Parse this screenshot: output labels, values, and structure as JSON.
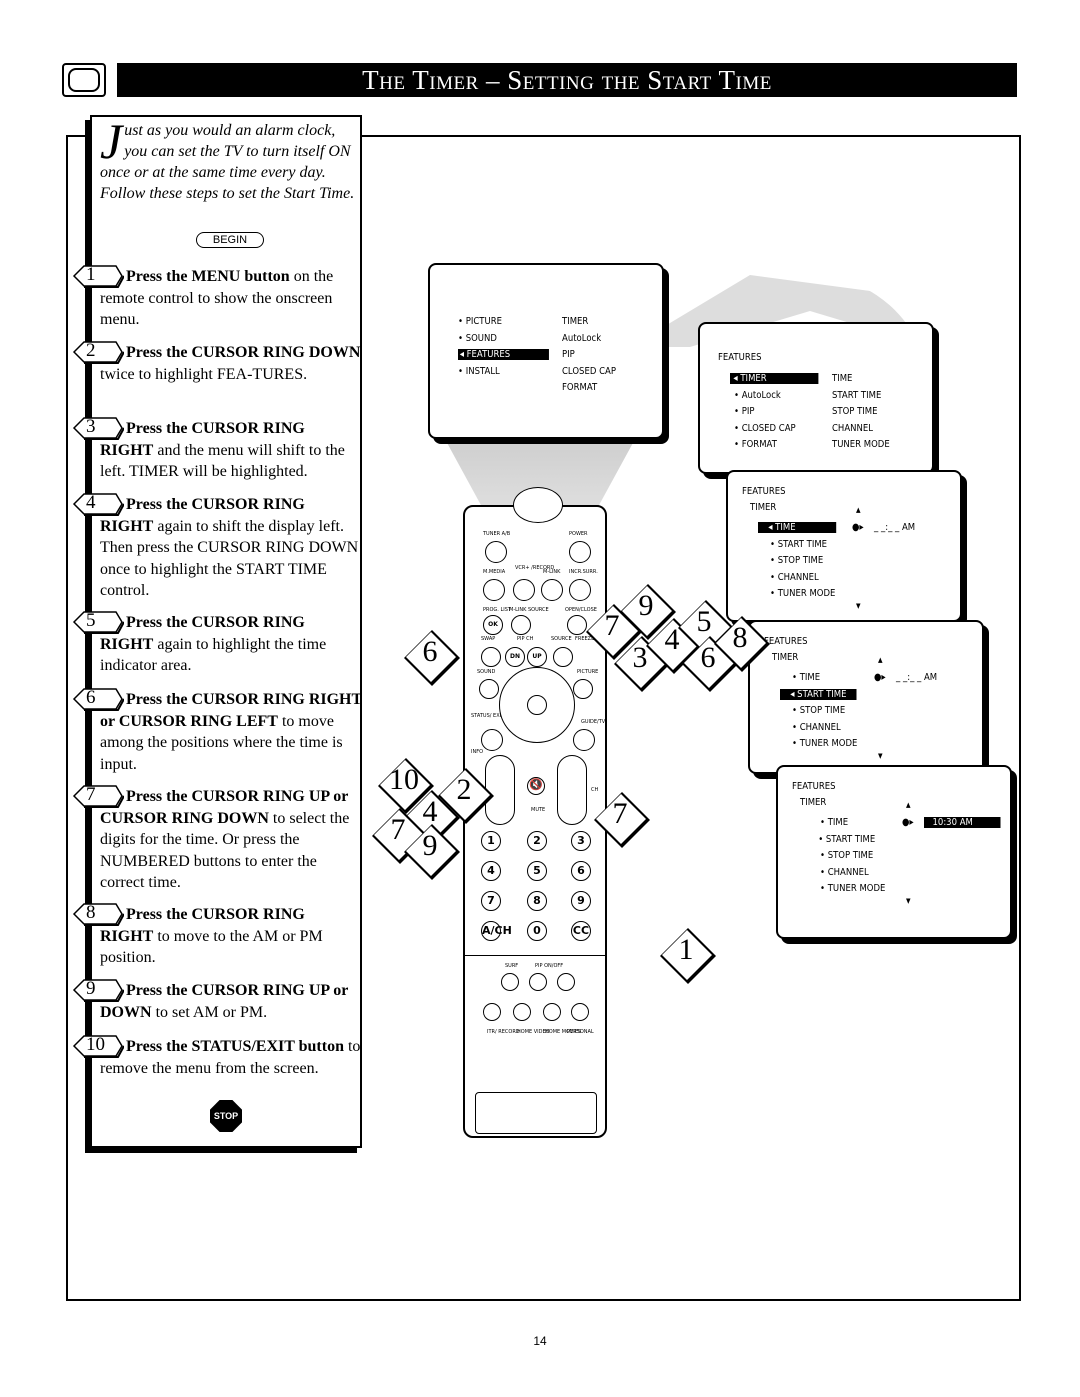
{
  "header": {
    "title": "The Timer – Setting the Start Time",
    "icon": "tv-icon"
  },
  "intro": {
    "dropcap": "J",
    "text": "ust as you would an alarm clock, you can set the TV to turn itself ON once or at the same time every day. Follow these steps to set the Start Time.",
    "begin_label": "BEGIN"
  },
  "steps": [
    {
      "num": "1",
      "bold": "Press the MENU button",
      "rest": " on the remote control to show the onscreen menu."
    },
    {
      "num": "2",
      "bold": "Press the CURSOR RING DOWN",
      "rest": " twice to highlight FEA-TURES."
    },
    {
      "num": "3",
      "bold": "Press the CURSOR RING RIGHT",
      "rest": " and the menu will shift to the left. TIMER will be highlighted."
    },
    {
      "num": "4",
      "bold": "Press the CURSOR RING RIGHT",
      "rest": " again to shift the display left. Then press the CURSOR RING DOWN once to highlight the START TIME control."
    },
    {
      "num": "5",
      "bold": "Press the CURSOR RING RIGHT",
      "rest": " again to highlight the time indicator area."
    },
    {
      "num": "6",
      "bold": "Press the CURSOR RING RIGHT or CURSOR RING LEFT",
      "rest": " to move among the positions where the time is input."
    },
    {
      "num": "7",
      "bold": "Press the CURSOR RING UP or CURSOR RING DOWN",
      "rest": " to select the digits for the time. Or press the NUMBERED buttons to enter the correct time."
    },
    {
      "num": "8",
      "bold": "Press the CURSOR RING RIGHT",
      "rest": " to move to the AM or PM position."
    },
    {
      "num": "9",
      "bold": "Press the CURSOR RING UP or DOWN",
      "rest": " to set AM or PM."
    },
    {
      "num": "10",
      "bold": "Press the STATUS/EXIT button",
      "rest": " to remove the menu from the screen."
    }
  ],
  "stop_label": "STOP",
  "menu1": {
    "left": [
      "PICTURE",
      "SOUND",
      "FEATURES",
      "INSTALL"
    ],
    "right": [
      "TIMER",
      "AutoLock",
      "PIP",
      "CLOSED CAP",
      "FORMAT"
    ],
    "highlighted": "FEATURES"
  },
  "menu2": {
    "title": "FEATURES",
    "left": [
      "TIMER",
      "AutoLock",
      "PIP",
      "CLOSED CAP",
      "FORMAT"
    ],
    "right": [
      "TIME",
      "START TIME",
      "STOP TIME",
      "CHANNEL",
      "TUNER MODE"
    ],
    "highlighted": "TIMER"
  },
  "menu3": {
    "title": "FEATURES",
    "sub": "TIMER",
    "items": [
      "TIME",
      "START TIME",
      "STOP TIME",
      "CHANNEL",
      "TUNER MODE"
    ],
    "highlighted": "TIME",
    "value": "_ _:_ _ AM"
  },
  "menu4": {
    "title": "FEATURES",
    "sub": "TIMER",
    "items": [
      "TIME",
      "START TIME",
      "STOP TIME",
      "CHANNEL",
      "TUNER MODE"
    ],
    "highlighted": "START TIME",
    "value": "_ _:_ _ AM"
  },
  "menu5": {
    "title": "FEATURES",
    "sub": "TIMER",
    "items": [
      "TIME",
      "START TIME",
      "STOP TIME",
      "CHANNEL",
      "TUNER MODE"
    ],
    "highlighted": "START TIME",
    "value": "10:30 AM"
  },
  "remote": {
    "labels": [
      "TUNER A/B",
      "POWER",
      "M.MEDIA",
      "VCR+ /RECORD",
      "M-LINK",
      "INCR.SURR.",
      "PROG. LIST",
      "M-LINK SOURCE",
      "OPEN/CLOSE",
      "SWAP",
      "PIP CH",
      "SOURCE",
      "FREEZE",
      "SOUND",
      "PICTURE",
      "STATUS/ EXIT",
      "GUIDE/TV",
      "INFO",
      "CH",
      "MUTE",
      "SURF",
      "PIP ON/OFF",
      "ITR/ RECORD",
      "HOME VIDEO",
      "HOME MOVIES",
      "PERSONAL"
    ],
    "buttons": [
      "OK",
      "DN",
      "UP",
      "1",
      "2",
      "3",
      "4",
      "5",
      "6",
      "7",
      "8",
      "9",
      "A/CH",
      "0",
      "CC"
    ]
  },
  "callouts": [
    "6",
    "10",
    "4",
    "2",
    "7",
    "9",
    "7",
    "9",
    "3",
    "4",
    "5",
    "6",
    "8",
    "7",
    "1"
  ],
  "page_number": "14"
}
